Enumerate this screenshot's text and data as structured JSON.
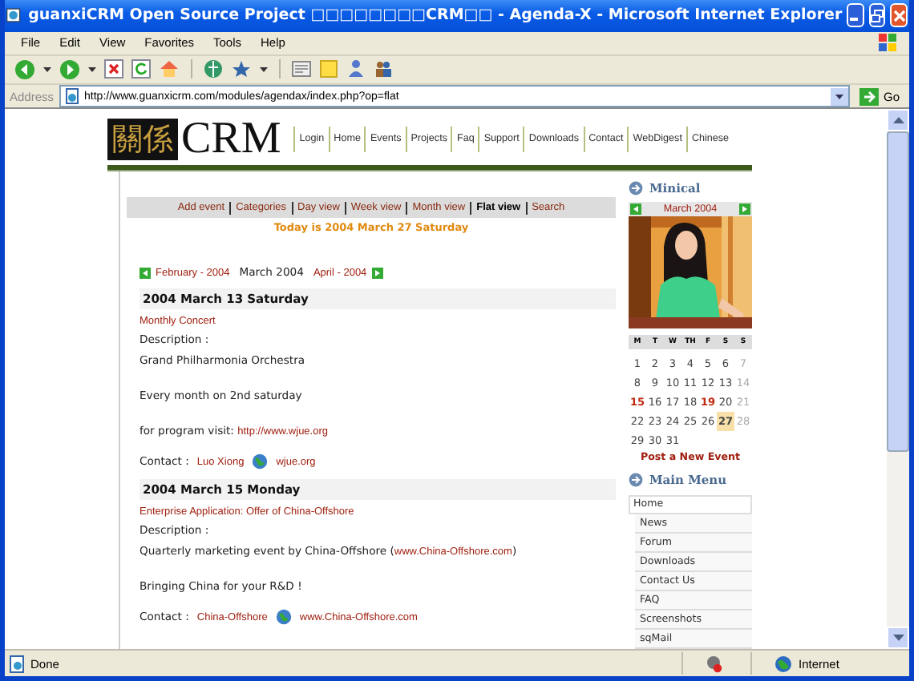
{
  "window": {
    "title": "guanxiCRM Open Source Project □□□□□□□□CRM□□ - Agenda-X - Microsoft Internet Explorer"
  },
  "menu_bar": [
    "File",
    "Edit",
    "View",
    "Favorites",
    "Tools",
    "Help"
  ],
  "address_bar": {
    "label": "Address",
    "url": "http://www.guanxicrm.com/modules/agendax/index.php?op=flat",
    "go": "Go"
  },
  "site": {
    "logo_chinese": "關係",
    "logo_text": "CRM",
    "nav": [
      "Login",
      "Home",
      "Events",
      "Projects",
      "Faq",
      "Support",
      "Downloads",
      "Contact",
      "WebDigest",
      "Chinese"
    ]
  },
  "agenda": {
    "tabs": [
      {
        "label": "Add event",
        "selected": false
      },
      {
        "label": "Categories",
        "selected": false
      },
      {
        "label": "Day view",
        "selected": false
      },
      {
        "label": "Week view",
        "selected": false
      },
      {
        "label": "Month view",
        "selected": false
      },
      {
        "label": "Flat view",
        "selected": true
      },
      {
        "label": "Search",
        "selected": false
      }
    ],
    "today": "Today is 2004 March 27 Saturday",
    "prev_month": "February - 2004",
    "current_month": "March 2004",
    "next_month": "April - 2004",
    "events": [
      {
        "date": "2004 March 13 Saturday",
        "title": "Monthly Concert",
        "description_label": "Description :",
        "paragraphs": [
          [
            {
              "text": "Grand Philharmonia Orchestra",
              "link": false
            }
          ],
          [
            {
              "text": "Every month on 2nd saturday",
              "link": false
            }
          ],
          [
            {
              "text": "for program visit: ",
              "link": false
            },
            {
              "text": "http://www.wjue.org",
              "link": true
            }
          ]
        ],
        "contact_label": "Contact :",
        "contact_name": "Luo Xiong",
        "contact_web": "wjue.org"
      },
      {
        "date": "2004 March 15 Monday",
        "title": "Enterprise Application: Offer of China-Offshore",
        "description_label": "Description :",
        "paragraphs": [
          [
            {
              "text": "Quarterly marketing event by China-Offshore (",
              "link": false
            },
            {
              "text": "www.China-Offshore.com",
              "link": true
            },
            {
              "text": ")",
              "link": false
            }
          ],
          [
            {
              "text": "Bringing China for your R&D !",
              "link": false
            }
          ]
        ],
        "contact_label": "Contact :",
        "contact_name": "China-Offshore",
        "contact_web": "www.China-Offshore.com"
      }
    ]
  },
  "minical": {
    "title": "Minical",
    "month": "March 2004",
    "weekdays": [
      "M",
      "T",
      "W",
      "TH",
      "F",
      "S",
      "S"
    ],
    "days": [
      {
        "day": "1",
        "event": false,
        "selected": false
      },
      {
        "day": "2",
        "event": false,
        "selected": false
      },
      {
        "day": "3",
        "event": false,
        "selected": false
      },
      {
        "day": "4",
        "event": false,
        "selected": false
      },
      {
        "day": "5",
        "event": false,
        "selected": false
      },
      {
        "day": "6",
        "event": false,
        "selected": false
      },
      {
        "day": "7",
        "event": false,
        "selected": false
      },
      {
        "day": "8",
        "event": false,
        "selected": false
      },
      {
        "day": "9",
        "event": false,
        "selected": false
      },
      {
        "day": "10",
        "event": false,
        "selected": false
      },
      {
        "day": "11",
        "event": false,
        "selected": false
      },
      {
        "day": "12",
        "event": false,
        "selected": false
      },
      {
        "day": "13",
        "event": false,
        "selected": false
      },
      {
        "day": "14",
        "event": false,
        "selected": false
      },
      {
        "day": "15",
        "event": true,
        "selected": false
      },
      {
        "day": "16",
        "event": false,
        "selected": false
      },
      {
        "day": "17",
        "event": false,
        "selected": false
      },
      {
        "day": "18",
        "event": false,
        "selected": false
      },
      {
        "day": "19",
        "event": true,
        "selected": false
      },
      {
        "day": "20",
        "event": false,
        "selected": false
      },
      {
        "day": "21",
        "event": false,
        "selected": false
      },
      {
        "day": "22",
        "event": false,
        "selected": false
      },
      {
        "day": "23",
        "event": false,
        "selected": false
      },
      {
        "day": "24",
        "event": false,
        "selected": false
      },
      {
        "day": "25",
        "event": false,
        "selected": false
      },
      {
        "day": "26",
        "event": false,
        "selected": false
      },
      {
        "day": "27",
        "event": false,
        "selected": true
      },
      {
        "day": "28",
        "event": false,
        "selected": false
      },
      {
        "day": "29",
        "event": false,
        "selected": false
      },
      {
        "day": "30",
        "event": false,
        "selected": false
      },
      {
        "day": "31",
        "event": false,
        "selected": false
      }
    ],
    "post_link": "Post a New Event"
  },
  "main_menu": {
    "title": "Main Menu",
    "items": [
      {
        "label": "Home",
        "children": [
          {
            "label": "News"
          },
          {
            "label": "Forum"
          },
          {
            "label": "Downloads"
          },
          {
            "label": "Contact Us"
          },
          {
            "label": "FAQ"
          },
          {
            "label": "Screenshots"
          },
          {
            "label": "sqMail"
          }
        ]
      }
    ]
  },
  "status_bar": {
    "status": "Done",
    "zone": "Internet"
  }
}
